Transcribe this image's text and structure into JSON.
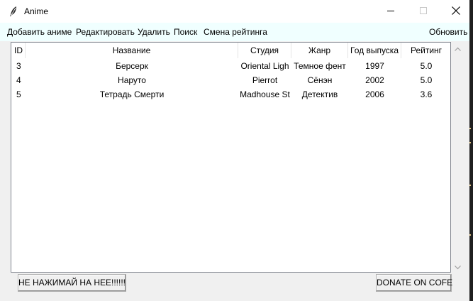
{
  "window": {
    "title": "Anime",
    "icons": {
      "app": "feather-icon",
      "minimize": "minimize-icon",
      "maximize": "maximize-icon",
      "close": "close-icon"
    }
  },
  "menu": {
    "items": [
      {
        "label": "Добавить аниме"
      },
      {
        "label": "Редактировать"
      },
      {
        "label": "Удалить"
      },
      {
        "label": "Поиск"
      },
      {
        "label": "Смена рейтинга"
      }
    ],
    "refresh_label": "Обновить"
  },
  "table": {
    "columns": [
      "ID",
      "Название",
      "Студия",
      "Жанр",
      "Год выпуска",
      "Рейтинг"
    ],
    "rows": [
      [
        "3",
        "Берсерк",
        "Oriental Ligh",
        "Темное фент",
        "1997",
        "5.0"
      ],
      [
        "4",
        "Наруто",
        "Pierrot",
        "Сёнэн",
        "2002",
        "5.0"
      ],
      [
        "5",
        "Тетрадь Смерти",
        "Madhouse St",
        "Детектив",
        "2006",
        "3.6"
      ]
    ]
  },
  "buttons": {
    "left_label": "НЕ НАЖИМАЙ НА НЕЕ!!!!!!",
    "right_label": "DONATE ON COFE"
  },
  "colors": {
    "menubar_bg": "#f0ffff",
    "window_bg": "#f0f0f0",
    "table_border": "#828790"
  }
}
